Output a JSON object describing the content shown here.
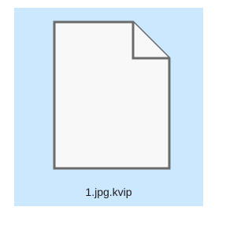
{
  "file": {
    "name": "1.jpg.kvip",
    "icon": "blank-document-icon",
    "selected": true
  },
  "colors": {
    "selection_background": "#cce8ff",
    "page_fill": "#f8f8f8",
    "page_outline": "#6b6b6b",
    "label_text": "#1a1a1a"
  }
}
